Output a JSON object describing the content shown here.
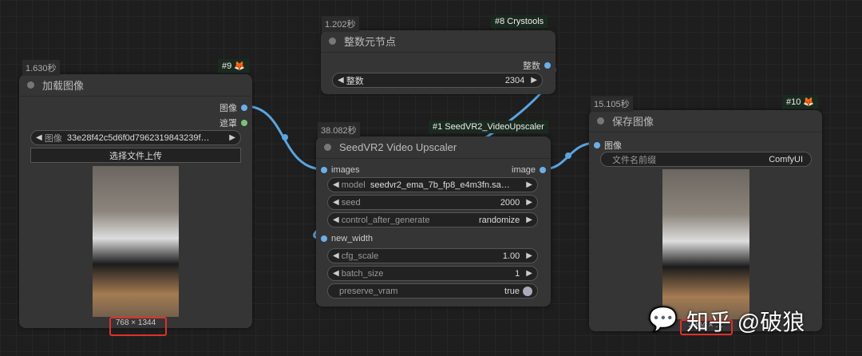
{
  "colors": {
    "link": "#5aa5e0",
    "mask": "#7ac27a"
  },
  "nodes": {
    "load": {
      "timer": "1.630秒",
      "badge": "#9 🦊",
      "title": "加载图像",
      "out_image": "图像",
      "out_mask": "遮罩",
      "combo_label": "图像",
      "combo_value": "33e28f42c5d6f0d7962319843239f…",
      "upload": "选择文件上传",
      "size": "768 × 1344"
    },
    "int": {
      "timer": "1.202秒",
      "badge": "#8 Crystools",
      "title": "整数元节点",
      "out": "整数",
      "w_label": "整数",
      "w_value": "2304"
    },
    "seed": {
      "timer": "38.082秒",
      "badge": "#1 SeedVR2_VideoUpscaler",
      "title": "SeedVR2 Video Upscaler",
      "in_images": "images",
      "out_image": "image",
      "new_width": "new_width",
      "widgets": [
        {
          "label": "model",
          "value": "seedvr2_ema_7b_fp8_e4m3fn.sa…"
        },
        {
          "label": "seed",
          "value": "2000"
        },
        {
          "label": "control_after_generate",
          "value": "randomize"
        },
        {
          "label": "cfg_scale",
          "value": "1.00"
        },
        {
          "label": "batch_size",
          "value": "1"
        }
      ],
      "toggle": {
        "label": "preserve_vram",
        "value": "true"
      }
    },
    "save": {
      "timer": "15.105秒",
      "badge": "#10 🦊",
      "title": "保存图像",
      "in_image": "图像",
      "w_label": "文件名前缀",
      "w_value": "ComfyUI",
      "size": "2304 × …"
    }
  },
  "watermark": "知乎 @破狼"
}
